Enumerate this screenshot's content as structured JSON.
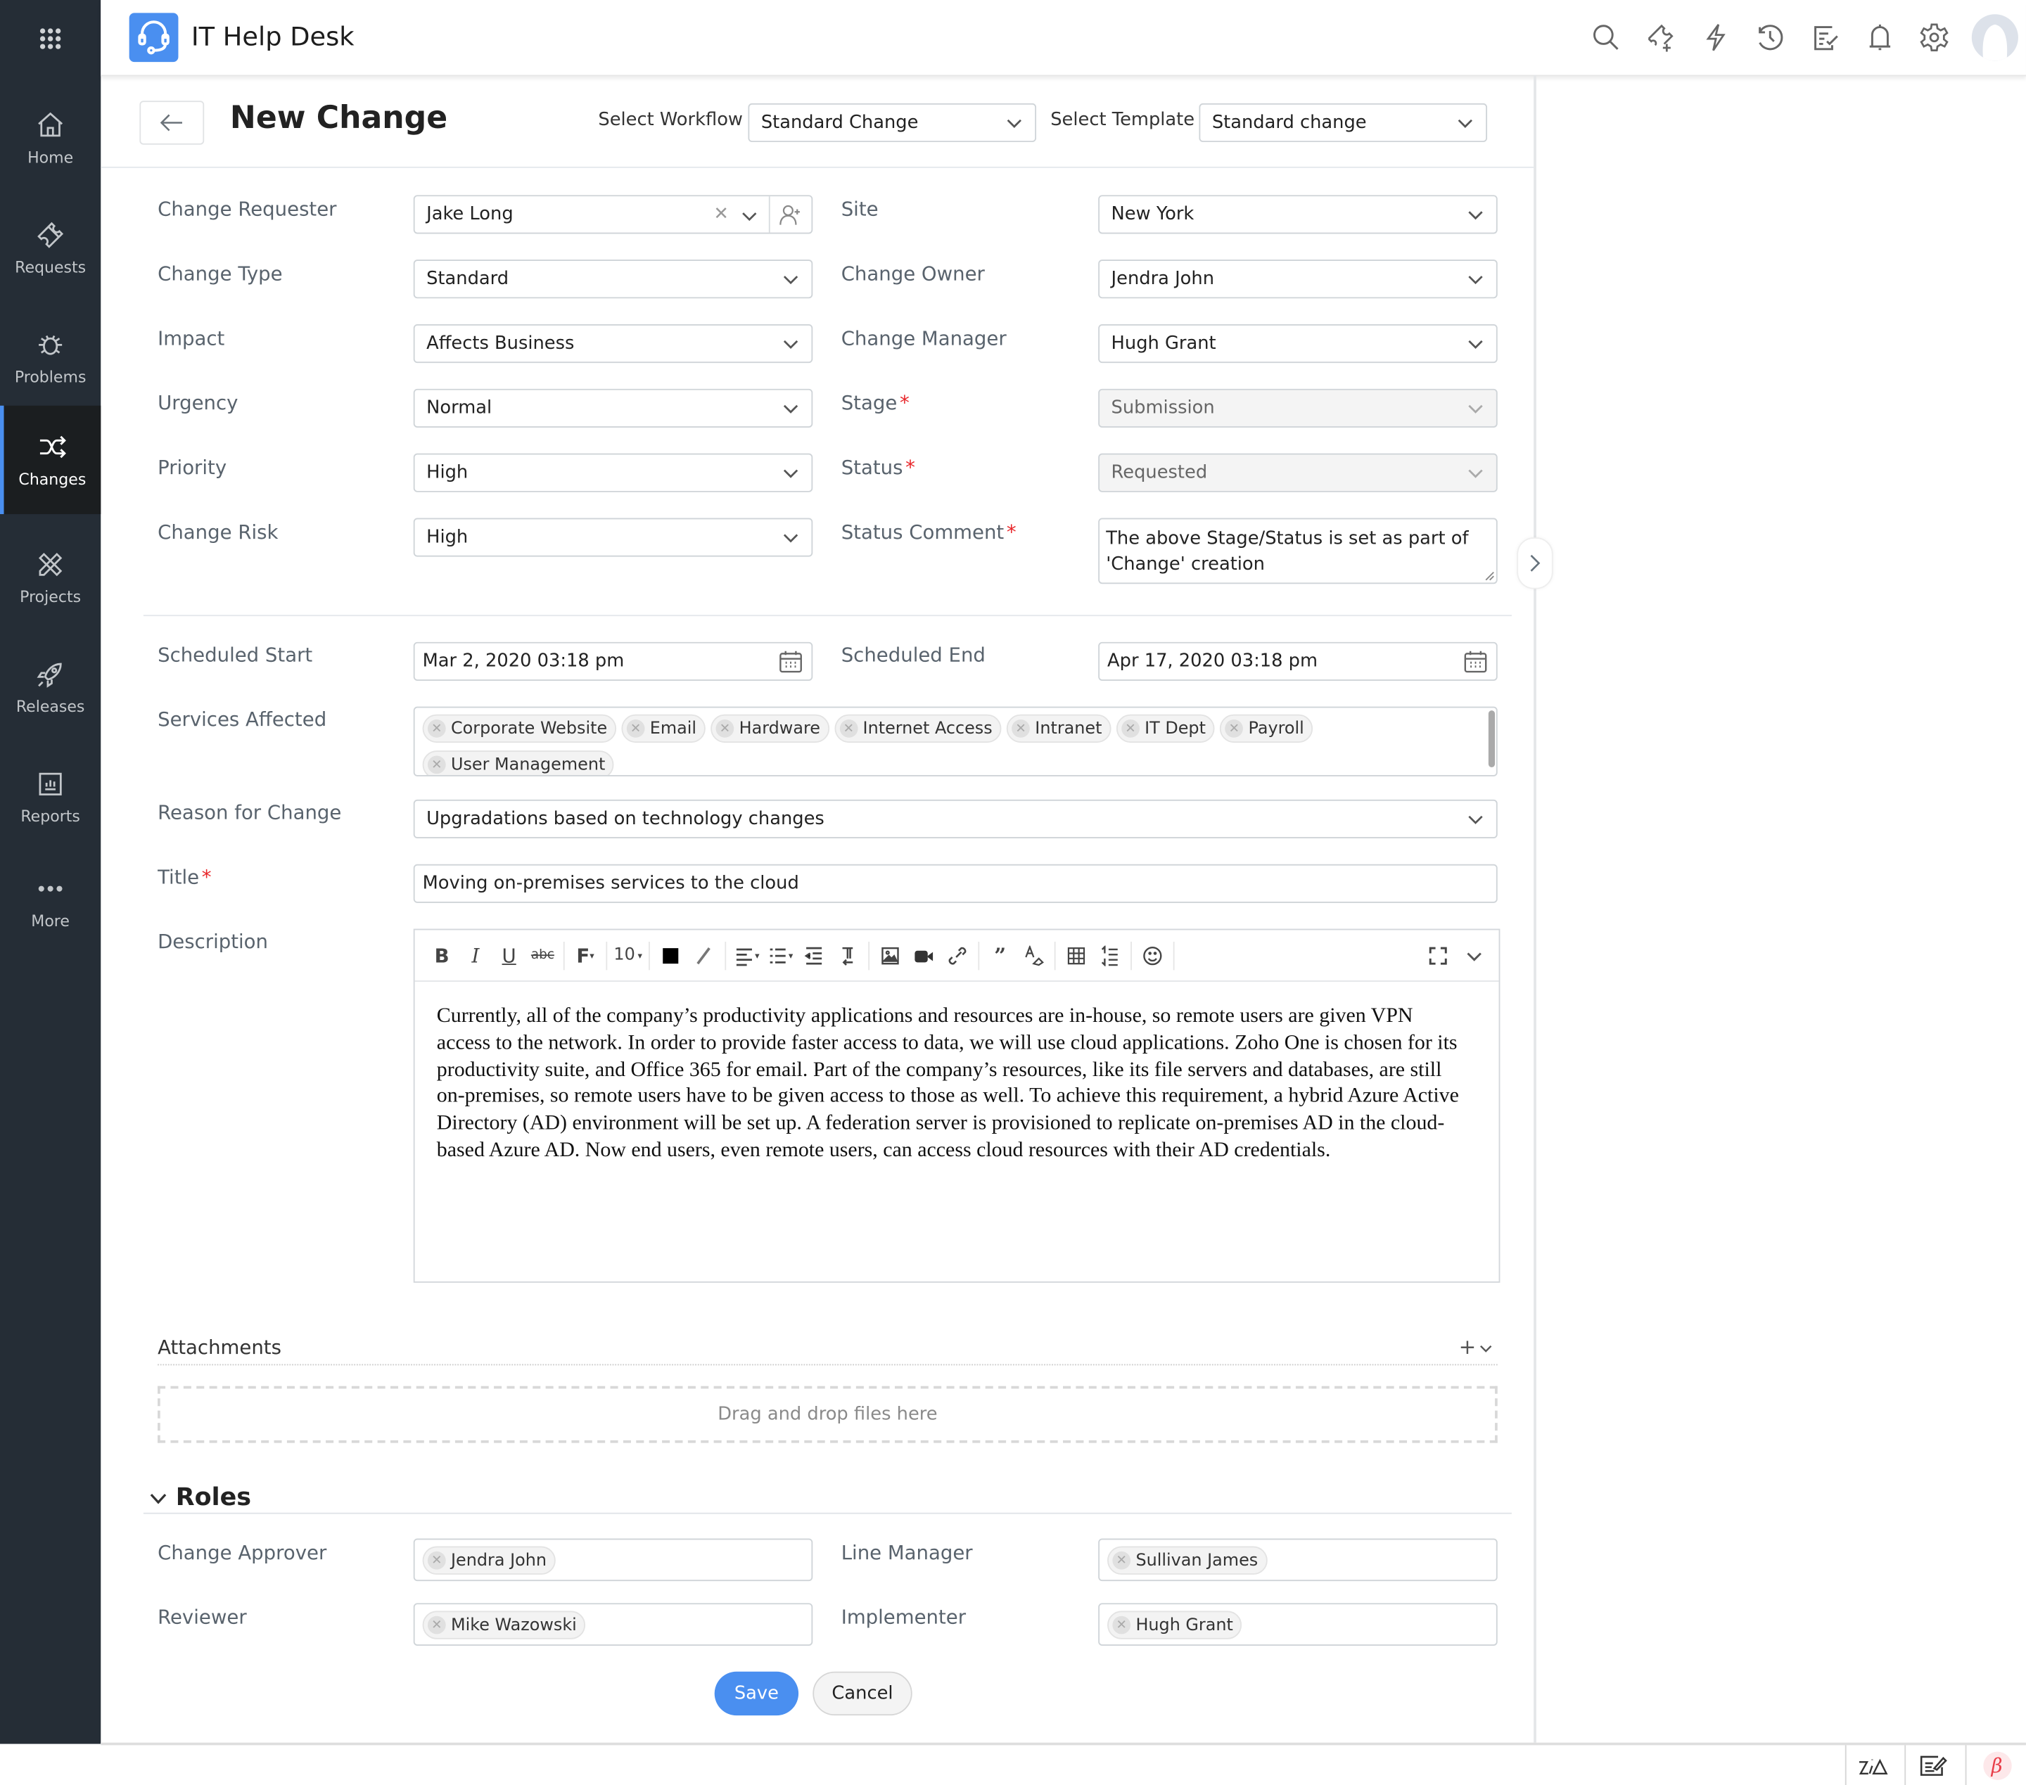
{
  "app": {
    "title": "IT Help Desk"
  },
  "sidebar": {
    "items": [
      {
        "label": "Home",
        "icon": "home-icon"
      },
      {
        "label": "Requests",
        "icon": "ticket-icon"
      },
      {
        "label": "Problems",
        "icon": "bug-icon"
      },
      {
        "label": "Changes",
        "icon": "shuffle-icon",
        "active": true
      },
      {
        "label": "Projects",
        "icon": "ruler-pencil-icon"
      },
      {
        "label": "Releases",
        "icon": "rocket-icon"
      },
      {
        "label": "Reports",
        "icon": "report-chart-icon"
      },
      {
        "label": "More",
        "icon": "more-dots-icon"
      }
    ]
  },
  "header": {
    "icons": [
      "search-icon",
      "new-ticket-icon",
      "quick-action-icon",
      "history-icon",
      "tasks-icon",
      "notification-bell-icon",
      "settings-gear-icon",
      "user-avatar"
    ]
  },
  "page": {
    "title": "New Change",
    "workflow_label": "Select Workflow",
    "workflow_value": "Standard Change",
    "template_label": "Select Template",
    "template_value": "Standard change"
  },
  "form": {
    "left": [
      {
        "label": "Change Requester",
        "value": "Jake Long"
      },
      {
        "label": "Change Type",
        "value": "Standard"
      },
      {
        "label": "Impact",
        "value": "Affects Business"
      },
      {
        "label": "Urgency",
        "value": "Normal"
      },
      {
        "label": "Priority",
        "value": "High"
      },
      {
        "label": "Change Risk",
        "value": "High"
      }
    ],
    "right": [
      {
        "label": "Site",
        "value": "New York"
      },
      {
        "label": "Change Owner",
        "value": "Jendra John"
      },
      {
        "label": "Change Manager",
        "value": "Hugh Grant"
      },
      {
        "label": "Stage",
        "value": "Submission",
        "required": true,
        "disabled": true
      },
      {
        "label": "Status",
        "value": "Requested",
        "required": true,
        "disabled": true
      },
      {
        "label": "Status Comment",
        "value": "The above Stage/Status is set as part of 'Change' creation",
        "required": true
      }
    ],
    "scheduled_start": {
      "label": "Scheduled Start",
      "value": "Mar 2, 2020 03:18 pm"
    },
    "scheduled_end": {
      "label": "Scheduled End",
      "value": "Apr 17, 2020 03:18 pm"
    },
    "services_affected": {
      "label": "Services Affected",
      "items": [
        "Corporate Website",
        "Email",
        "Hardware",
        "Internet Access",
        "Intranet",
        "IT Dept",
        "Payroll",
        "User Management"
      ]
    },
    "reason": {
      "label": "Reason for Change",
      "value": "Upgradations based on technology changes"
    },
    "title": {
      "label": "Title",
      "value": "Moving on-premises services to the cloud",
      "required": true
    },
    "description": {
      "label": "Description",
      "font_size": "10",
      "text": "Currently, all of the company’s productivity applications and resources are in-house, so remote users are given VPN access to the network. In order to provide faster access to data, we will use cloud applications. Zoho One is chosen for its productivity suite, and Office 365 for email. Part of the company’s resources, like its file servers and databases, are still on-premises, so remote users have to be given access to those as well. To achieve this requirement, a hybrid Azure Active Directory (AD) environment will be set up. A federation server is provisioned to replicate on-premises AD in the cloud-based Azure AD. Now end users, even remote users, can access cloud resources with their AD credentials."
    }
  },
  "attachments": {
    "label": "Attachments",
    "dropzone": "Drag and drop files here"
  },
  "roles": {
    "heading": "Roles",
    "change_approver": {
      "label": "Change Approver",
      "value": "Jendra John"
    },
    "line_manager": {
      "label": "Line Manager",
      "value": "Sullivan James"
    },
    "reviewer": {
      "label": "Reviewer",
      "value": "Mike Wazowski"
    },
    "implementer": {
      "label": "Implementer",
      "value": "Hugh Grant"
    }
  },
  "actions": {
    "save": "Save",
    "cancel": "Cancel"
  },
  "footer": {
    "beta": "β"
  },
  "colors": {
    "accent": "#4a8ff0",
    "sidebar": "#252d36",
    "required": "#e8262a"
  }
}
